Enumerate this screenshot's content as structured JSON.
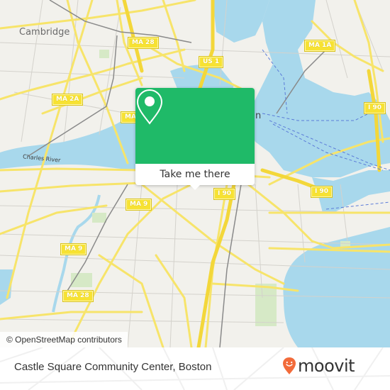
{
  "map": {
    "place_labels": {
      "cambridge": "Cambridge",
      "charles_river": "Charles River",
      "boston_partial": "n"
    },
    "road_shields": [
      {
        "id": "ma28-north",
        "label": "MA 28"
      },
      {
        "id": "us1",
        "label": "US 1"
      },
      {
        "id": "ma1a",
        "label": "MA 1A"
      },
      {
        "id": "ma2a",
        "label": "MA 2A"
      },
      {
        "id": "ma-partial",
        "label": "MA"
      },
      {
        "id": "i90-east",
        "label": "I 90"
      },
      {
        "id": "i90-south",
        "label": "I 90"
      },
      {
        "id": "i90-center",
        "label": "I 90"
      },
      {
        "id": "ma9-center",
        "label": "MA 9"
      },
      {
        "id": "ma9-west",
        "label": "MA 9"
      },
      {
        "id": "ma28-south",
        "label": "MA 28"
      }
    ],
    "attribution": "© OpenStreetMap contributors",
    "colors": {
      "land": "#f2f1ec",
      "water": "#a8d8ec",
      "road": "#f7e46a",
      "park": "#d6e9c6"
    }
  },
  "popup": {
    "icon": "map-pin-icon",
    "button_label": "Take me there",
    "color": "#1fba68"
  },
  "footer": {
    "title": "Castle Square Community Center, Boston",
    "logo_text": "moovit",
    "logo_icon": "moovit-pin-smile-icon",
    "logo_color": "#f26b3a"
  }
}
